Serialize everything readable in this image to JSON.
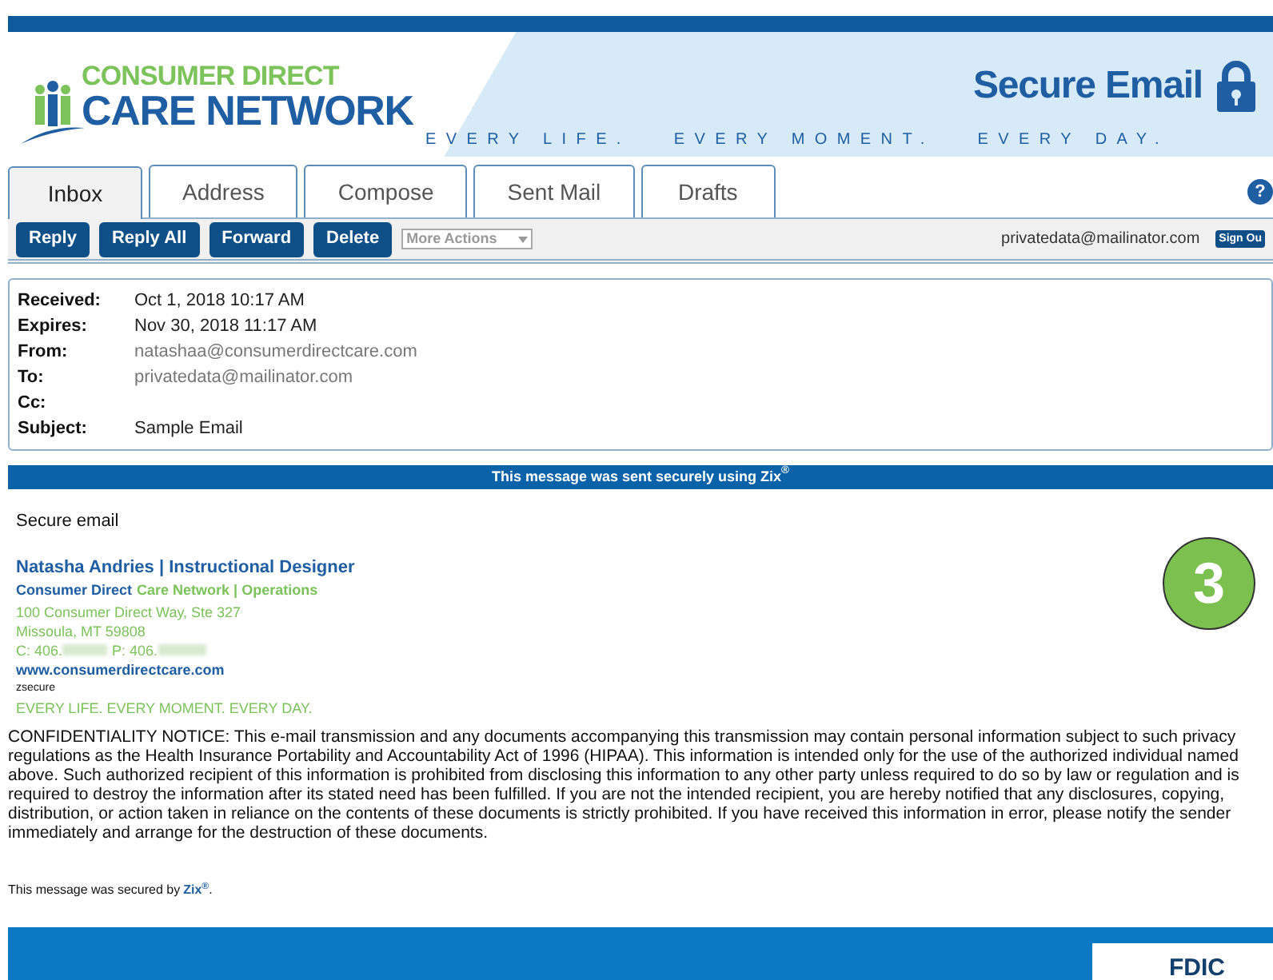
{
  "header": {
    "logo_top": "CONSUMER DIRECT",
    "logo_bottom": "CARE NETWORK",
    "title": "Secure Email",
    "tagline": "EVERY LIFE.   EVERY MOMENT.   EVERY DAY."
  },
  "tabs": [
    {
      "label": "Inbox",
      "selected": true
    },
    {
      "label": "Address",
      "selected": false
    },
    {
      "label": "Compose",
      "selected": false
    },
    {
      "label": "Sent Mail",
      "selected": false
    },
    {
      "label": "Drafts",
      "selected": false
    }
  ],
  "help": "?",
  "toolbar": {
    "buttons": [
      "Reply",
      "Reply All",
      "Forward",
      "Delete"
    ],
    "dropdown": "More Actions",
    "user": "privatedata@mailinator.com",
    "sign_out": "Sign Ou"
  },
  "message_header": [
    {
      "label": "Received:",
      "value": "Oct 1, 2018 10:17 AM",
      "kind": "date"
    },
    {
      "label": "Expires:",
      "value": "Nov 30, 2018 11:17 AM",
      "kind": "date"
    },
    {
      "label": "From:",
      "value": "natashaa@consumerdirectcare.com",
      "kind": "address"
    },
    {
      "label": "To:",
      "value": "privatedata@mailinator.com",
      "kind": "address"
    },
    {
      "label": "Cc:"
    },
    {
      "label": "Subject:",
      "value": "Sample Email",
      "kind": "date"
    }
  ],
  "secure_banner": "This message was sent securely using Zix$^{®}$",
  "body": {
    "greeting": "Secure email",
    "signature": {
      "name": "Natasha Andries | Instructional Designer",
      "org_blue": "Consumer Direct",
      "org_green": "Care Network | Operations",
      "address1": "100 Consumer Direct Way, Ste 327",
      "address2": "Missoula, MT 59808",
      "phone_c": "C: 406.",
      "phone_p": "P: 406.",
      "website": "www.consumerdirectcare.com",
      "tag": "zsecure",
      "slogan": "EVERY LIFE.  EVERY MOMENT.  EVERY DAY."
    },
    "badge": "3",
    "notice": "CONFIDENTIALITY NOTICE: This e-mail transmission and any documents accompanying this transmission may contain personal information subject to such privacy regulations as the Health Insurance Portability and Accountability Act of 1996 (HIPAA). This information is intended only for the use of the authorized individual named above. Such authorized recipient of this information is prohibited from disclosing this information to any other party unless required to do so by law or regulation and is required to destroy the information after its stated need has been fulfilled. If you are not the intended recipient, you are hereby notified that any disclosures, copying, distribution, or action taken in reliance on the contents of these documents is strictly prohibited. If you have received this information in error, please notify the sender immediately and arrange for the destruction of these documents.",
    "secured_by": "This message was secured by",
    "zix_link": "Zix$^{®}$",
    "secured_end": "."
  },
  "footer": {
    "fdic": "FDIC"
  }
}
